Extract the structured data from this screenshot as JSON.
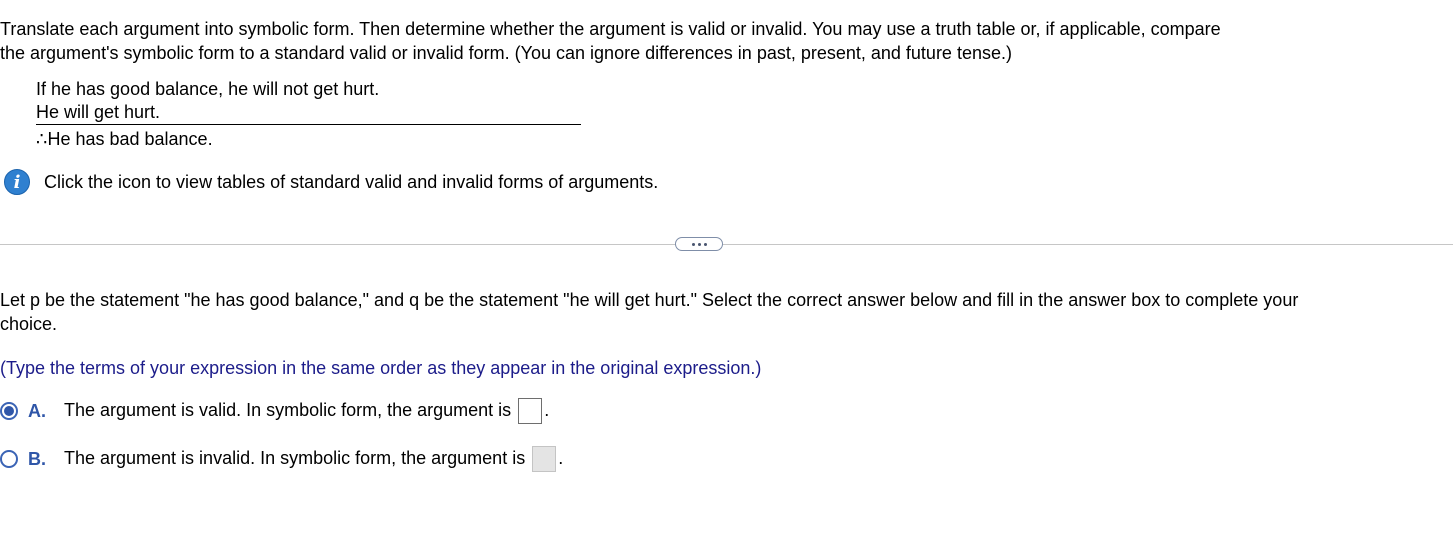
{
  "intro": {
    "line1": "Translate each argument into symbolic form. Then determine whether the argument is valid or invalid. You may use a truth table or, if applicable, compare",
    "line2": "the argument's symbolic form to a standard valid or invalid form. (You can ignore differences in past, present, and future tense.)"
  },
  "argument": {
    "premise1": "If he has good balance, he will not get hurt.",
    "premise2": "He will get hurt.",
    "therefore_symbol": "∴",
    "conclusion": "He has bad balance."
  },
  "info": {
    "icon": "info-icon",
    "icon_glyph": "i",
    "text": "Click the icon to view tables of standard valid and invalid forms of arguments.",
    "icon_color": "#2f80d0"
  },
  "more_button": {
    "icon": "ellipsis-icon"
  },
  "question": {
    "line1": "Let p be the statement \"he has good balance,\" and q be the statement \"he will get hurt.\" Select the correct answer below and fill in the answer box to complete your",
    "line2": "choice."
  },
  "instruction": "(Type the terms of your expression in the same order as they appear in the original expression.)",
  "choices": [
    {
      "letter": "A.",
      "text": "The argument is valid. In symbolic form, the argument is",
      "suffix": ".",
      "selected": true,
      "value": ""
    },
    {
      "letter": "B.",
      "text": "The argument is invalid. In symbolic form, the argument is",
      "suffix": ".",
      "selected": false,
      "value": ""
    }
  ],
  "colors": {
    "accent": "#2f56a8",
    "instruction_text": "#1c1c8a",
    "divider": "#c6c6c6"
  }
}
